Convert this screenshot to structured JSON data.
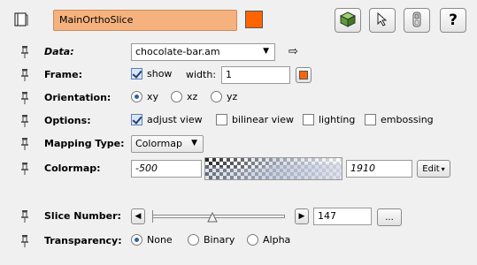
{
  "header": {
    "module_name": "MainOrthoSlice",
    "color_swatch": "#ff6400",
    "icons": [
      "book-icon",
      "cube-icon",
      "pointer-icon",
      "viewer-toggle-icon",
      "help-icon"
    ],
    "help_label": "?"
  },
  "rows": {
    "data": {
      "label": "Data:",
      "value": "chocolate-bar.am"
    },
    "frame": {
      "label": "Frame:",
      "show_label": "show",
      "show_checked": true,
      "width_label": "width:",
      "width_value": "1",
      "color": "#ff6400"
    },
    "orientation": {
      "label": "Orientation:",
      "options": [
        "xy",
        "xz",
        "yz"
      ],
      "selected": "xy"
    },
    "options": {
      "label": "Options:",
      "items": [
        "adjust view",
        "bilinear view",
        "lighting",
        "embossing"
      ],
      "checked": [
        "adjust view"
      ]
    },
    "mapping": {
      "label": "Mapping Type:",
      "value": "Colormap"
    },
    "colormap": {
      "label": "Colormap:",
      "min": "-500",
      "max": "1910",
      "edit_label": "Edit"
    },
    "slice": {
      "label": "Slice Number:",
      "value": "147",
      "more_label": "...",
      "position": 0.45
    },
    "transparency": {
      "label": "Transparency:",
      "options": [
        "None",
        "Binary",
        "Alpha"
      ],
      "selected": "None"
    }
  }
}
